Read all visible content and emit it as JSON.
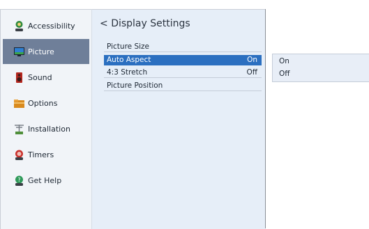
{
  "sidebar": {
    "items": [
      {
        "label": "Accessibility",
        "icon": "accessibility-icon"
      },
      {
        "label": "Picture",
        "icon": "monitor-icon"
      },
      {
        "label": "Sound",
        "icon": "speaker-icon"
      },
      {
        "label": "Options",
        "icon": "folder-icon"
      },
      {
        "label": "Installation",
        "icon": "antenna-icon"
      },
      {
        "label": "Timers",
        "icon": "timer-icon"
      },
      {
        "label": "Get Help",
        "icon": "help-icon"
      }
    ],
    "selected": "Picture"
  },
  "panel": {
    "back_glyph": "<",
    "title": "Display Settings",
    "rows": [
      {
        "label": "Picture Size",
        "value": ""
      },
      {
        "label": "Auto Aspect",
        "value": "On"
      },
      {
        "label": "4:3 Stretch",
        "value": "Off"
      },
      {
        "label": "Picture Position",
        "value": ""
      }
    ]
  },
  "popup": {
    "options": [
      "On",
      "Off"
    ]
  },
  "colors": {
    "selected_row": "#2b6fc0",
    "selected_sidebar": "#6f7f99"
  }
}
